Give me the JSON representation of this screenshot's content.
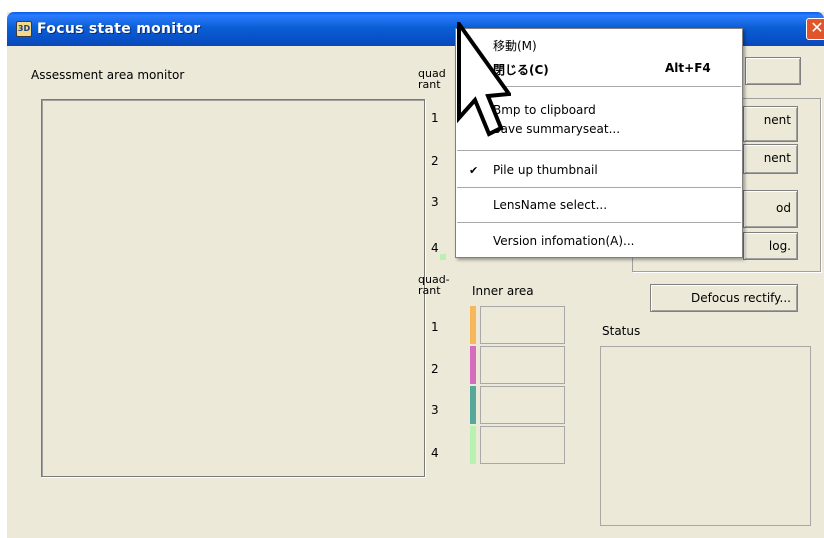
{
  "window": {
    "title": "Focus state monitor",
    "app_icon_text": "3D"
  },
  "assessment": {
    "label": "Assessment area monitor"
  },
  "quadrant_top": {
    "header": "quad\nrant",
    "rows": [
      "1",
      "2",
      "3",
      "4"
    ]
  },
  "quadrant_inner": {
    "header": "quad-\nrant",
    "area_label": "Inner area",
    "rows": [
      "1",
      "2",
      "3",
      "4"
    ],
    "colors": [
      "#f6b85a",
      "#d76cbc",
      "#54a89c",
      "#b8f2b0"
    ]
  },
  "buttons": {
    "b1": "nent",
    "b2": "nent",
    "b3": "od",
    "b4": "log.",
    "defocus": "Defocus rectify..."
  },
  "status": {
    "label": "Status"
  },
  "menu": {
    "items": [
      {
        "label": "移動(M)",
        "shortcut": "",
        "checked": false,
        "bold": false
      },
      {
        "label": "閉じる(C)",
        "shortcut": "Alt+F4",
        "checked": false,
        "bold": true
      },
      {
        "label": "Bmp to clipboard",
        "shortcut": "",
        "checked": false,
        "bold": false
      },
      {
        "label": "Save summaryseat...",
        "shortcut": "",
        "checked": false,
        "bold": false
      },
      {
        "label": "Pile up thumbnail",
        "shortcut": "",
        "checked": true,
        "bold": false
      },
      {
        "label": "LensName select...",
        "shortcut": "",
        "checked": false,
        "bold": false
      },
      {
        "label": "Version infomation(A)...",
        "shortcut": "",
        "checked": false,
        "bold": false
      }
    ],
    "check_glyph": "✔"
  },
  "icons": {
    "cursor": "arrow-cursor-icon",
    "close": "close-icon",
    "check": "checkmark-icon"
  }
}
